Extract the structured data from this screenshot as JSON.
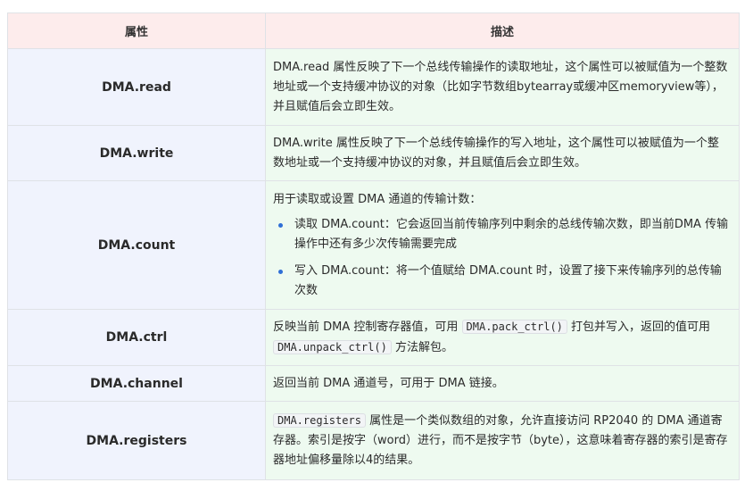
{
  "table": {
    "headers": {
      "property": "属性",
      "description": "描述"
    },
    "rows": [
      {
        "name": "DMA.read",
        "desc": "DMA.read 属性反映了下一个总线传输操作的读取地址，这个属性可以被赋值为一个整数地址或一个支持缓冲协议的对象（比如字节数组bytearray或缓冲区memoryview等），并且赋值后会立即生效。"
      },
      {
        "name": "DMA.write",
        "desc": "DMA.write 属性反映了下一个总线传输操作的写入地址，这个属性可以被赋值为一个整数地址或一个支持缓冲协议的对象，并且赋值后会立即生效。"
      },
      {
        "name": "DMA.count",
        "intro": "用于读取或设置 DMA 通道的传输计数：",
        "bullets": [
          "读取 DMA.count：它会返回当前传输序列中剩余的总线传输次数，即当前DMA 传输操作中还有多少次传输需要完成",
          "写入 DMA.count：将一个值赋给 DMA.count 时，设置了接下来传输序列的总传输次数"
        ]
      },
      {
        "name": "DMA.ctrl",
        "desc_a": "反映当前 DMA 控制寄存器值，可用",
        "code_a": "DMA.pack_ctrl()",
        "desc_b": "打包并写入，返回的值可用",
        "code_b": "DMA.unpack_ctrl()",
        "desc_c": "方法解包。"
      },
      {
        "name": "DMA.channel",
        "desc": "返回当前 DMA 通道号，可用于 DMA 链接。"
      },
      {
        "name": "DMA.registers",
        "code": "DMA.registers",
        "desc": "属性是一个类似数组的对象，允许直接访问 RP2040 的 DMA 通道寄存器。索引是按字（word）进行，而不是按字节（byte），这意味着寄存器的索引是寄存器地址偏移量除以4的结果。"
      }
    ]
  }
}
